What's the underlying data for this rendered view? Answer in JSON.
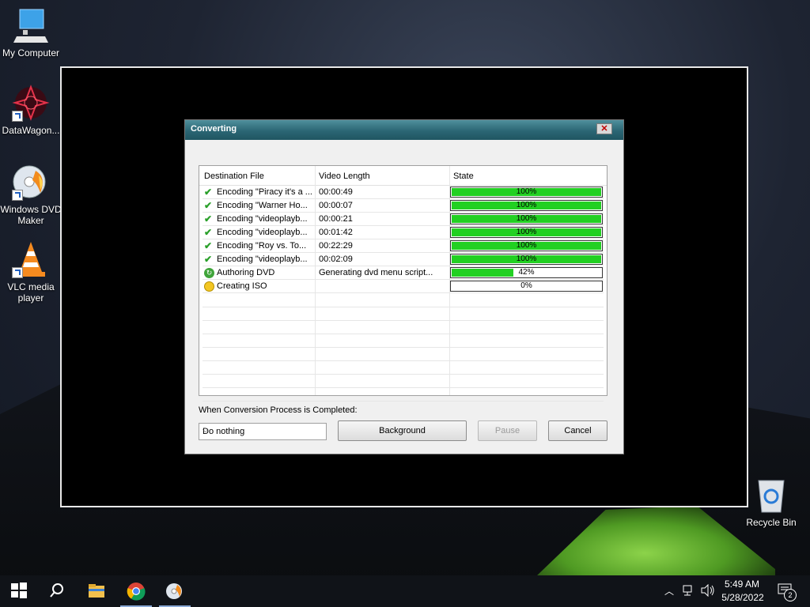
{
  "desktop": {
    "icons": [
      {
        "label": "My Computer",
        "icon": "computer-icon"
      },
      {
        "label": "DataWagon...",
        "icon": "datawagon-icon"
      },
      {
        "label": "Windows DVD Maker",
        "icon": "dvd-maker-icon"
      },
      {
        "label": "VLC media player",
        "icon": "vlc-icon"
      },
      {
        "label": "Recycle Bin",
        "icon": "recycle-bin-icon"
      }
    ]
  },
  "dialog": {
    "title": "Converting",
    "close_glyph": "✕",
    "columns": [
      "Destination File",
      "Video Length",
      "State"
    ],
    "rows": [
      {
        "status": "done",
        "file": "Encoding \"Piracy it's a ...",
        "length": "00:00:49",
        "progress": 100,
        "progress_text": "100%"
      },
      {
        "status": "done",
        "file": "Encoding \"Warner Ho...",
        "length": "00:00:07",
        "progress": 100,
        "progress_text": "100%"
      },
      {
        "status": "done",
        "file": "Encoding \"videoplayb...",
        "length": "00:00:21",
        "progress": 100,
        "progress_text": "100%"
      },
      {
        "status": "done",
        "file": "Encoding \"videoplayb...",
        "length": "00:01:42",
        "progress": 100,
        "progress_text": "100%"
      },
      {
        "status": "done",
        "file": "Encoding \"Roy vs. To...",
        "length": "00:22:29",
        "progress": 100,
        "progress_text": "100%"
      },
      {
        "status": "done",
        "file": "Encoding \"videoplayb...",
        "length": "00:02:09",
        "progress": 100,
        "progress_text": "100%"
      },
      {
        "status": "working",
        "file": "Authoring DVD",
        "length": "Generating dvd menu script...",
        "progress": 42,
        "progress_text": "42%"
      },
      {
        "status": "pending",
        "file": "Creating ISO",
        "length": "",
        "progress": 0,
        "progress_text": "0%"
      }
    ],
    "completion_label": "When Conversion Process is Completed:",
    "completion_option": "Do nothing",
    "buttons": {
      "background": "Background",
      "pause": "Pause",
      "cancel": "Cancel"
    },
    "colors": {
      "progress_fill": "#22d022",
      "title_bar": "#2b6674"
    }
  },
  "taskbar": {
    "pinned": [
      "start-icon",
      "search-icon",
      "file-explorer-icon",
      "chrome-icon",
      "dvd-app-icon"
    ],
    "clock_time": "5:49 AM",
    "clock_date": "5/28/2022",
    "notification_count": "2"
  }
}
